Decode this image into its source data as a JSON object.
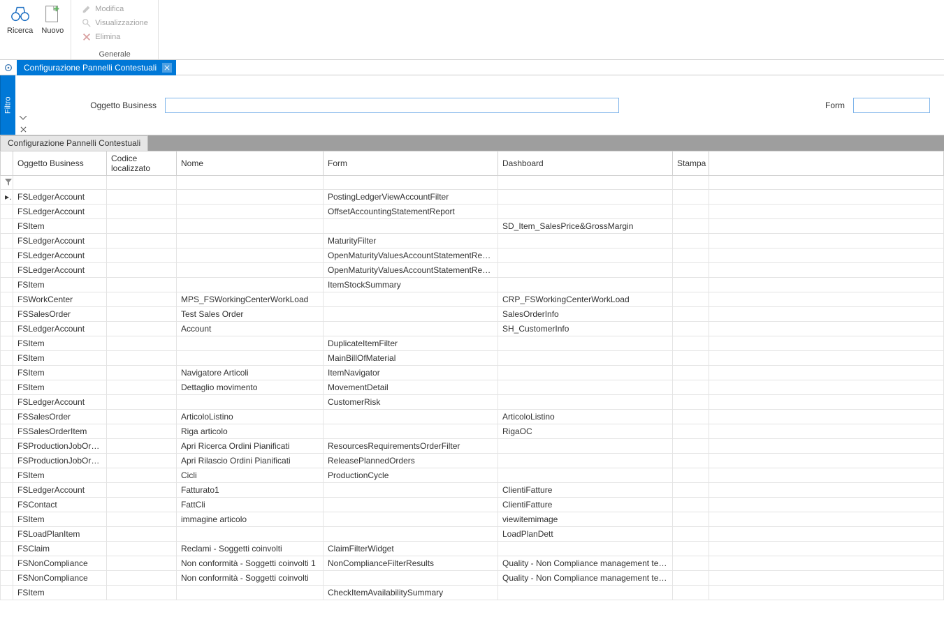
{
  "ribbon": {
    "group1_label": "",
    "ricerca": "Ricerca",
    "nuovo": "Nuovo",
    "generale_label": "Generale",
    "modifica": "Modifica",
    "visualizzazione": "Visualizzazione",
    "elimina": "Elimina"
  },
  "window_tab": {
    "title": "Configurazione Pannelli Contestuali"
  },
  "filter": {
    "tab_label": "Filtro",
    "oggetto_business_label": "Oggetto Business",
    "oggetto_business_value": "",
    "form_label": "Form",
    "form_value": ""
  },
  "grid": {
    "tab_title": "Configurazione Pannelli Contestuali",
    "columns": {
      "oggetto_business": "Oggetto Business",
      "codice": "Codice localizzato",
      "nome": "Nome",
      "form": "Form",
      "dashboard": "Dashboard",
      "stampa": "Stampa"
    },
    "rows": [
      {
        "marker": "▸",
        "ob": "FSLedgerAccount",
        "codice": "",
        "nome": "",
        "form": "PostingLedgerViewAccountFilter",
        "dash": "",
        "stampa": ""
      },
      {
        "marker": "",
        "ob": "FSLedgerAccount",
        "codice": "",
        "nome": "",
        "form": "OffsetAccountingStatementReport",
        "dash": "",
        "stampa": ""
      },
      {
        "marker": "",
        "ob": "FSItem",
        "codice": "",
        "nome": "",
        "form": "",
        "dash": "SD_Item_SalesPrice&GrossMargin",
        "stampa": ""
      },
      {
        "marker": "",
        "ob": "FSLedgerAccount",
        "codice": "",
        "nome": "",
        "form": "MaturityFilter",
        "dash": "",
        "stampa": ""
      },
      {
        "marker": "",
        "ob": "FSLedgerAccount",
        "codice": "",
        "nome": "",
        "form": "OpenMaturityValuesAccountStatementReport",
        "dash": "",
        "stampa": ""
      },
      {
        "marker": "",
        "ob": "FSLedgerAccount",
        "codice": "",
        "nome": "",
        "form": "OpenMaturityValuesAccountStatementReport",
        "dash": "",
        "stampa": ""
      },
      {
        "marker": "",
        "ob": "FSItem",
        "codice": "",
        "nome": "",
        "form": "ItemStockSummary",
        "dash": "",
        "stampa": ""
      },
      {
        "marker": "",
        "ob": "FSWorkCenter",
        "codice": "",
        "nome": "MPS_FSWorkingCenterWorkLoad",
        "form": "",
        "dash": "CRP_FSWorkingCenterWorkLoad",
        "stampa": ""
      },
      {
        "marker": "",
        "ob": "FSSalesOrder",
        "codice": "",
        "nome": "Test Sales Order",
        "form": "",
        "dash": "SalesOrderInfo",
        "stampa": ""
      },
      {
        "marker": "",
        "ob": "FSLedgerAccount",
        "codice": "",
        "nome": "Account",
        "form": "",
        "dash": "SH_CustomerInfo",
        "stampa": ""
      },
      {
        "marker": "",
        "ob": "FSItem",
        "codice": "",
        "nome": "",
        "form": "DuplicateItemFilter",
        "dash": "",
        "stampa": ""
      },
      {
        "marker": "",
        "ob": "FSItem",
        "codice": "",
        "nome": "",
        "form": "MainBillOfMaterial",
        "dash": "",
        "stampa": ""
      },
      {
        "marker": "",
        "ob": "FSItem",
        "codice": "",
        "nome": "Navigatore Articoli",
        "form": "ItemNavigator",
        "dash": "",
        "stampa": ""
      },
      {
        "marker": "",
        "ob": "FSItem",
        "codice": "",
        "nome": "Dettaglio movimento",
        "form": "MovementDetail",
        "dash": "",
        "stampa": ""
      },
      {
        "marker": "",
        "ob": "FSLedgerAccount",
        "codice": "",
        "nome": "",
        "form": "CustomerRisk",
        "dash": "",
        "stampa": ""
      },
      {
        "marker": "",
        "ob": "FSSalesOrder",
        "codice": "",
        "nome": "ArticoloListino",
        "form": "",
        "dash": "ArticoloListino",
        "stampa": ""
      },
      {
        "marker": "",
        "ob": "FSSalesOrderItem",
        "codice": "",
        "nome": "Riga articolo",
        "form": "",
        "dash": "RigaOC",
        "stampa": ""
      },
      {
        "marker": "",
        "ob": "FSProductionJobOrder",
        "codice": "",
        "nome": "Apri Ricerca Ordini Pianificati",
        "form": "ResourcesRequirementsOrderFilter",
        "dash": "",
        "stampa": ""
      },
      {
        "marker": "",
        "ob": "FSProductionJobOrder",
        "codice": "",
        "nome": "Apri Rilascio Ordini Pianificati",
        "form": "ReleasePlannedOrders",
        "dash": "",
        "stampa": ""
      },
      {
        "marker": "",
        "ob": "FSItem",
        "codice": "",
        "nome": "Cicli",
        "form": "ProductionCycle",
        "dash": "",
        "stampa": ""
      },
      {
        "marker": "",
        "ob": "FSLedgerAccount",
        "codice": "",
        "nome": "Fatturato1",
        "form": "",
        "dash": "ClientiFatture",
        "stampa": ""
      },
      {
        "marker": "",
        "ob": "FSContact",
        "codice": "",
        "nome": "FattCli",
        "form": "",
        "dash": "ClientiFatture",
        "stampa": ""
      },
      {
        "marker": "",
        "ob": "FSItem",
        "codice": "",
        "nome": "immagine articolo",
        "form": "",
        "dash": "viewitemimage",
        "stampa": ""
      },
      {
        "marker": "",
        "ob": "FSLoadPlanItem",
        "codice": "",
        "nome": "",
        "form": "",
        "dash": "LoadPlanDett",
        "stampa": ""
      },
      {
        "marker": "",
        "ob": "FSClaim",
        "codice": "",
        "nome": "Reclami - Soggetti coinvolti",
        "form": "ClaimFilterWidget",
        "dash": "",
        "stampa": ""
      },
      {
        "marker": "",
        "ob": "FSNonCompliance",
        "codice": "",
        "nome": "Non conformità - Soggetti coinvolti 1",
        "form": "NonComplianceFilterResults",
        "dash": "Quality - Non Compliance management team",
        "stampa": ""
      },
      {
        "marker": "",
        "ob": "FSNonCompliance",
        "codice": "",
        "nome": "Non conformità - Soggetti coinvolti",
        "form": "",
        "dash": "Quality - Non Compliance management team",
        "stampa": ""
      },
      {
        "marker": "",
        "ob": "FSItem",
        "codice": "",
        "nome": "",
        "form": "CheckItemAvailabilitySummary",
        "dash": "",
        "stampa": ""
      }
    ]
  }
}
